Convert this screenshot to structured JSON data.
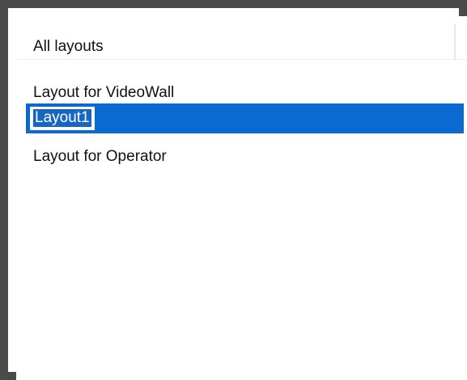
{
  "list": {
    "header": "All layouts",
    "items": [
      {
        "label": "Layout for VideoWall"
      },
      {
        "label": "Layout1"
      },
      {
        "label": "Layout for Operator"
      }
    ],
    "selected_index": 1,
    "editing_value": "Layout1"
  },
  "colors": {
    "selection": "#0a6ad1",
    "frame": "#4a4a4a"
  }
}
